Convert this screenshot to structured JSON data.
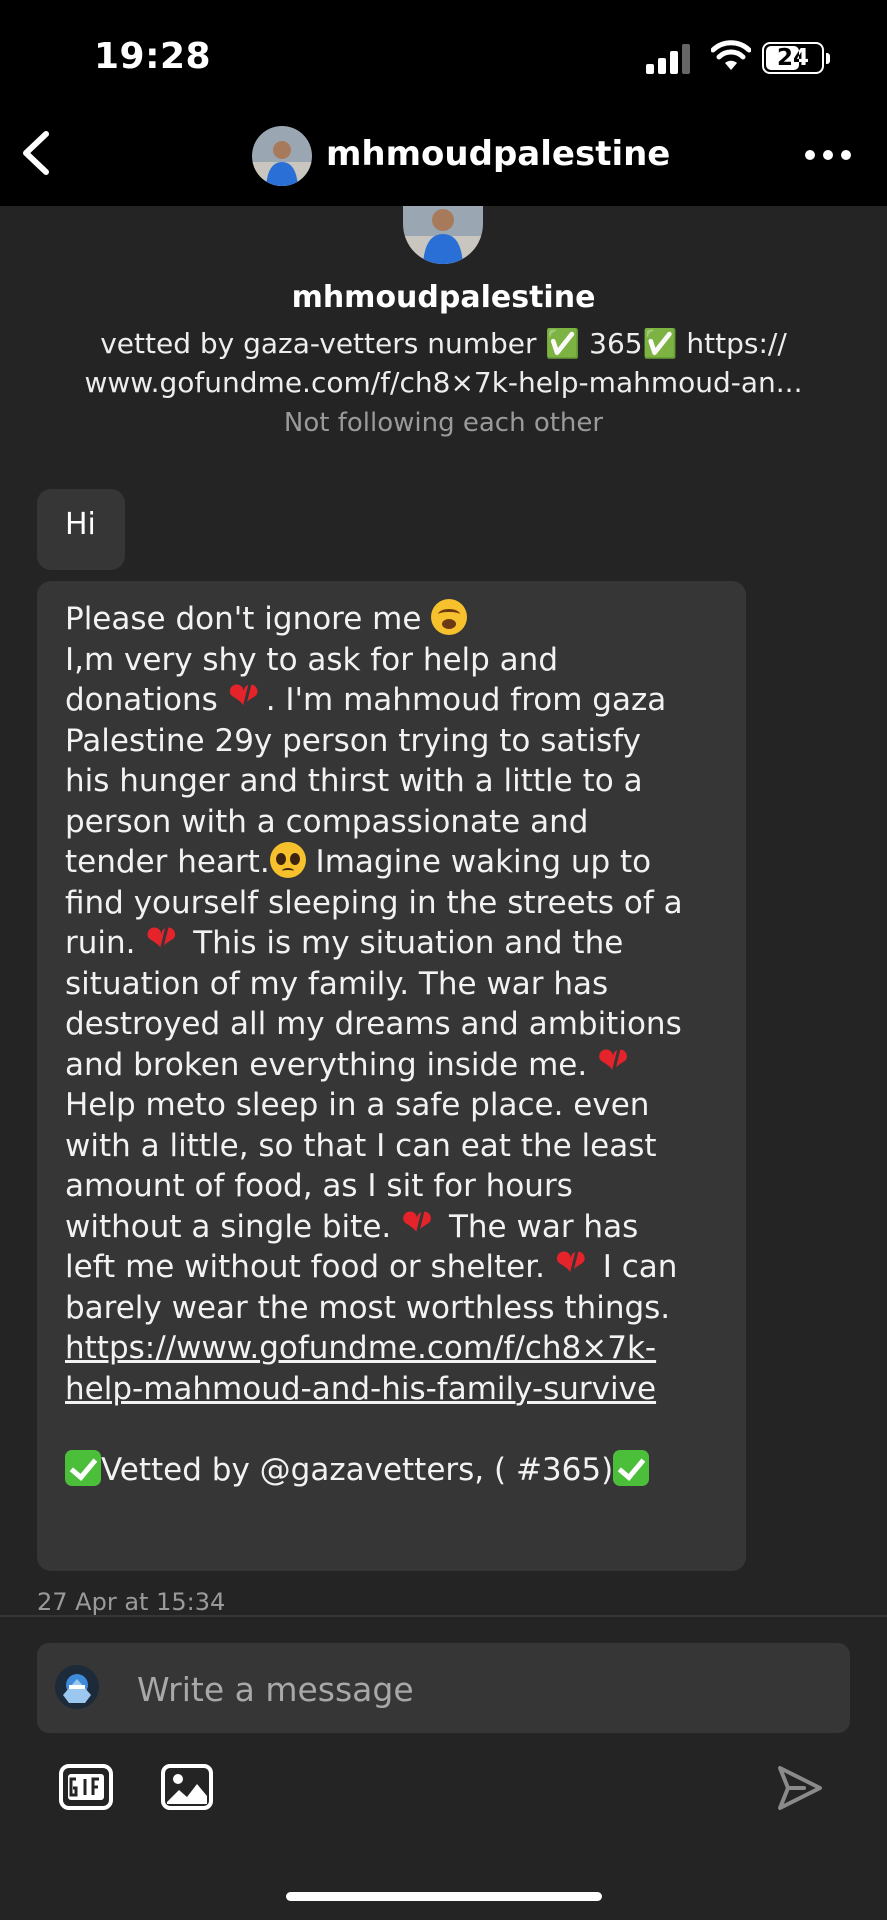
{
  "status_bar": {
    "time": "19:28",
    "battery": "24"
  },
  "header": {
    "username": "mhmoudpalestine"
  },
  "profile": {
    "username": "mhmoudpalestine",
    "bio_line1": "vetted by gaza-vetters number ✅ 365✅ https://",
    "bio_line2": "www.gofundme.com/f/ch8×7k-help-mahmoud-an...",
    "follow_status": "Not following each other"
  },
  "messages": [
    {
      "text": "Hi"
    },
    {
      "lines": [
        "Please don't ignore me ",
        "I,m very shy to ask for help and",
        "donations ",
        ". I'm mahmoud from gaza",
        "Palestine 29y person trying to satisfy",
        "his hunger and thirst with a little to a",
        "person with a compassionate and",
        "tender heart.",
        " Imagine waking up to",
        "find yourself sleeping in the streets of a",
        "ruin. ",
        " This is my situation and the",
        "situation of my family. The war has",
        "destroyed all my dreams and ambitions",
        "and broken everything inside me. ",
        "Help meto sleep in a safe place. even",
        "with a little, so that I can eat the least",
        "amount of food, as I sit for hours",
        "without a single bite. ",
        " The war has",
        "left me without food or shelter. ",
        " I can",
        "barely wear the most worthless things.",
        "https://www.gofundme.com/f/ch8×7k-",
        "help-mahmoud-and-his-family-survive",
        "Vetted by @gazavetters, ( #365)"
      ]
    }
  ],
  "timestamp": "27 Apr at 15:34",
  "composer": {
    "placeholder": "Write a message"
  },
  "icons": {
    "cry": "loudly-crying-face-emoji",
    "heart": "broken-heart-emoji",
    "plead": "pleading-face-emoji",
    "check": "check-mark-button-emoji"
  }
}
